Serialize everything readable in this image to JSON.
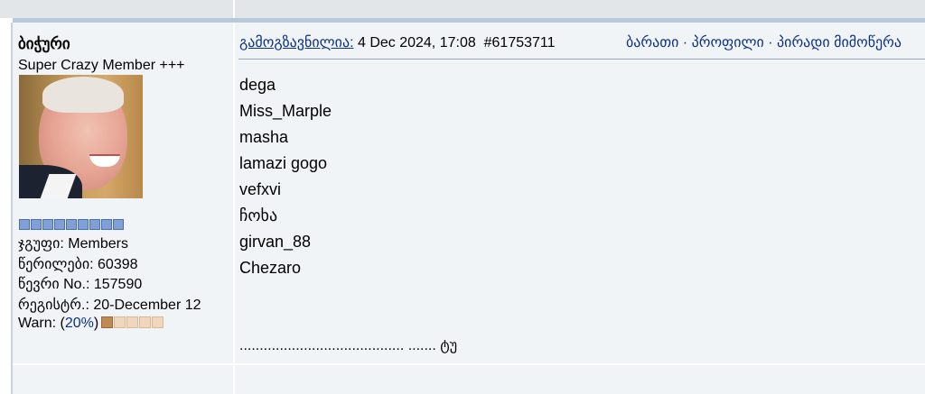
{
  "author": {
    "username": "ბიჭური",
    "rank": "Super Crazy Member +++",
    "stats": [
      "ჯგუფი: Members",
      "წერილები: 60398",
      "წევრი No.: 157590",
      "რეგისტრ.: 20-December 12"
    ],
    "warn_label_prefix": "Warn: (",
    "warn_percent": "20%",
    "warn_label_suffix": ")",
    "warn_level": 0.2
  },
  "post": {
    "sent_label": "გამოგზავნილია:",
    "date": "4 Dec 2024, 17:08",
    "number": "#61753711",
    "links": "ბარათი · პროფილი · პირადი მიმოწერა",
    "lines": [
      "dega",
      "Miss_Marple",
      "masha",
      "lamazi gogo",
      "vefxvi",
      "ჩოხა",
      "girvan_88",
      "Chezaro"
    ],
    "signature": "......................................... ....... ტუ"
  },
  "colors": {
    "link": "#0b2f8a",
    "row_bg": "#f1f4f6",
    "top_bar": "#e2e6e9",
    "divider": "#b8c9dc"
  }
}
